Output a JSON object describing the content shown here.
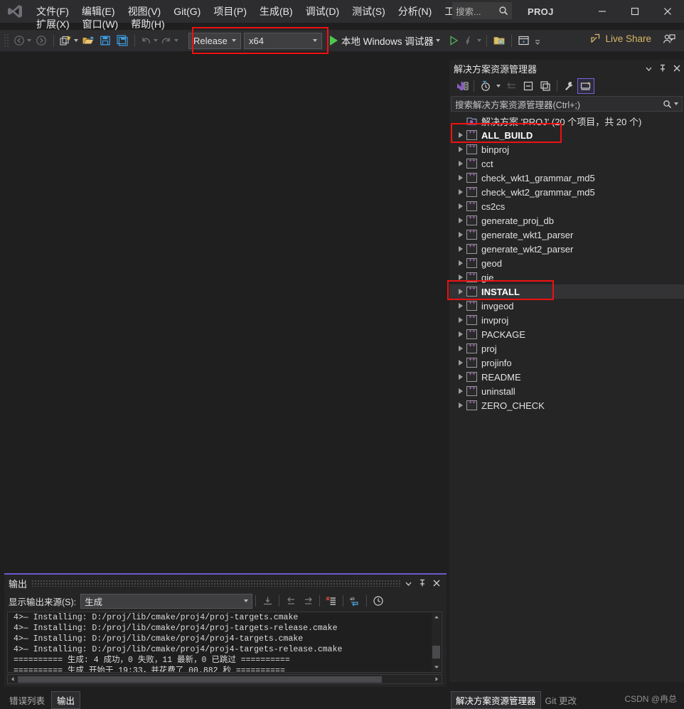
{
  "window": {
    "app_title": "PROJ",
    "logo": "visual-studio-logo",
    "controls": {
      "minimize": "—",
      "maximize": "☐",
      "close": "✕"
    }
  },
  "menu": {
    "row1": [
      {
        "label": "文件(F)"
      },
      {
        "label": "编辑(E)"
      },
      {
        "label": "视图(V)"
      },
      {
        "label": "Git(G)"
      },
      {
        "label": "项目(P)"
      },
      {
        "label": "生成(B)"
      },
      {
        "label": "调试(D)"
      },
      {
        "label": "测试(S)"
      },
      {
        "label": "分析(N)"
      },
      {
        "label": "工具(T)"
      }
    ],
    "row2": [
      {
        "label": "扩展(X)"
      },
      {
        "label": "窗口(W)"
      },
      {
        "label": "帮助(H)"
      }
    ]
  },
  "search": {
    "placeholder": "搜索...",
    "icon": "search-icon"
  },
  "toolbar": {
    "navigate_back": "back-arrow-icon",
    "navigate_forward": "forward-arrow-icon",
    "new_project": "new-project-icon",
    "open_file": "open-folder-icon",
    "save": "save-icon",
    "save_all": "save-all-icon",
    "undo": "undo-icon",
    "redo": "redo-icon",
    "configuration": "Release",
    "platform": "x64",
    "debug_target": "本地 Windows 调试器",
    "start_no_debug": "start-without-debugging-icon",
    "hot_reload": "hot-reload-icon",
    "folder_search": "folder-search-icon",
    "window_layout": "window-layout-icon",
    "live_share": "Live Share",
    "feedback": "feedback-icon"
  },
  "solution_explorer": {
    "title": "解决方案资源管理器",
    "header_buttons": {
      "dropdown": "chevron-down-icon",
      "pin": "pin-icon",
      "close": "close-icon"
    },
    "toolbar": {
      "code_view": "code-view-icon",
      "pending_changes": "pending-changes-icon",
      "sync_active": "sync-with-active-document-icon",
      "collapse_all": "collapse-all-icon",
      "show_all_files": "show-all-files-icon",
      "properties": "properties-wrench-icon",
      "preview": "preview-selected-items-icon"
    },
    "search_placeholder": "搜索解决方案资源管理器(Ctrl+;)",
    "root": "解决方案 'PROJ' (20 个项目，共 20 个)",
    "items": [
      {
        "label": "ALL_BUILD",
        "highlighted": true,
        "selected": false
      },
      {
        "label": "binproj",
        "highlighted": false,
        "selected": false
      },
      {
        "label": "cct",
        "highlighted": false,
        "selected": false
      },
      {
        "label": "check_wkt1_grammar_md5",
        "highlighted": false,
        "selected": false
      },
      {
        "label": "check_wkt2_grammar_md5",
        "highlighted": false,
        "selected": false
      },
      {
        "label": "cs2cs",
        "highlighted": false,
        "selected": false
      },
      {
        "label": "generate_proj_db",
        "highlighted": false,
        "selected": false
      },
      {
        "label": "generate_wkt1_parser",
        "highlighted": false,
        "selected": false
      },
      {
        "label": "generate_wkt2_parser",
        "highlighted": false,
        "selected": false
      },
      {
        "label": "geod",
        "highlighted": false,
        "selected": false
      },
      {
        "label": "gie",
        "highlighted": false,
        "selected": false
      },
      {
        "label": "INSTALL",
        "highlighted": true,
        "selected": true
      },
      {
        "label": "invgeod",
        "highlighted": false,
        "selected": false
      },
      {
        "label": "invproj",
        "highlighted": false,
        "selected": false
      },
      {
        "label": "PACKAGE",
        "highlighted": false,
        "selected": false
      },
      {
        "label": "proj",
        "highlighted": false,
        "selected": false
      },
      {
        "label": "projinfo",
        "highlighted": false,
        "selected": false
      },
      {
        "label": "README",
        "highlighted": false,
        "selected": false
      },
      {
        "label": "uninstall",
        "highlighted": false,
        "selected": false
      },
      {
        "label": "ZERO_CHECK",
        "highlighted": false,
        "selected": false
      }
    ],
    "bottom_tabs": [
      {
        "label": "解决方案资源管理器",
        "active": true
      },
      {
        "label": "Git 更改",
        "active": false
      }
    ]
  },
  "output": {
    "title": "输出",
    "source_label": "显示输出来源(S):",
    "source_value": "生成",
    "toolbar": {
      "clear_all": "clear-all-icon",
      "go_to_previous": "previous-message-icon",
      "go_to_next": "next-message-icon",
      "toggle_errors": "toggle-error-messages-icon",
      "word_wrap": "word-wrap-icon",
      "show_timestamps": "timestamps-clock-icon"
    },
    "lines": [
      "4>— Installing: D:/proj/lib/cmake/proj4/proj-targets.cmake",
      "4>— Installing: D:/proj/lib/cmake/proj4/proj-targets-release.cmake",
      "4>— Installing: D:/proj/lib/cmake/proj4/proj4-targets.cmake",
      "4>— Installing: D:/proj/lib/cmake/proj4/proj4-targets-release.cmake",
      "========== 生成: 4 成功，0 失败，11 最新，0 已跳过 ==========",
      "========== 生成 开始于 19:33，并花费了 00.882 秒 =========="
    ],
    "header_buttons": {
      "dropdown": "chevron-down-icon",
      "pin": "pin-icon",
      "close": "close-icon"
    },
    "bottom_tabs": [
      {
        "label": "错误列表",
        "active": false
      },
      {
        "label": "输出",
        "active": true
      }
    ]
  },
  "watermark": {
    "text": "CSDN @冉总"
  },
  "colors": {
    "titlebar_bg": "#2d2d30",
    "editor_bg": "#1f1f1f",
    "panel_bg": "#252526",
    "highlight_red": "#ee1111",
    "accent_purple": "#6a5acd",
    "link_gold": "#d8b765",
    "green_run": "#4ec94e"
  }
}
